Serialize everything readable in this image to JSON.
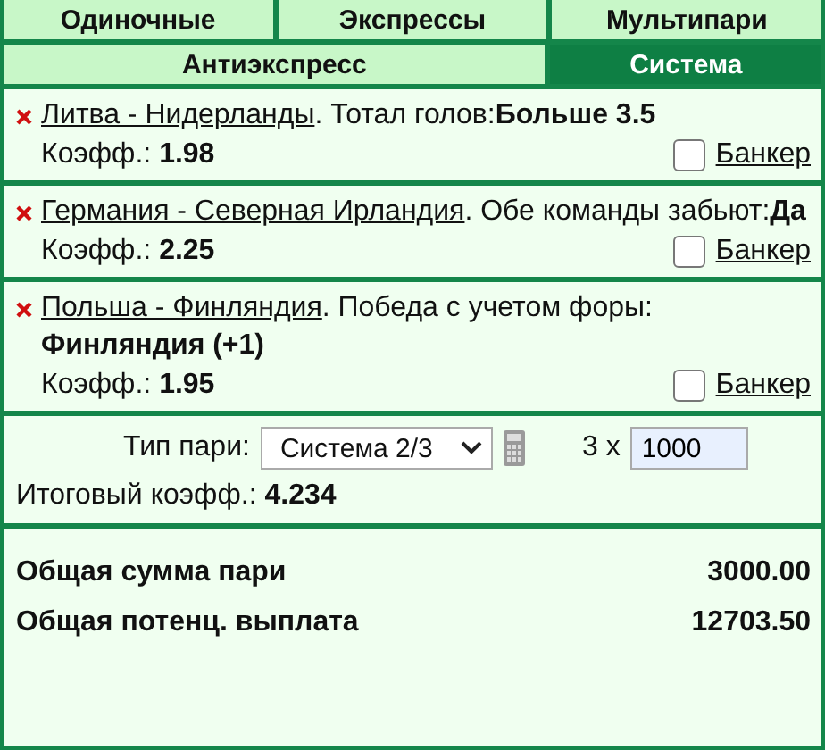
{
  "tab_rows": [
    [
      {
        "label": "Одиночные",
        "selected": false
      },
      {
        "label": "Экспрессы",
        "selected": false
      },
      {
        "label": "Мультипари",
        "selected": false
      }
    ],
    [
      {
        "label": "Антиэкспресс",
        "selected": false
      },
      {
        "label": "Система",
        "selected": true
      }
    ]
  ],
  "bets": [
    {
      "event": "Литва - Нидерланды",
      "market": ". Тотал голов:**Больше 3.5**",
      "odds_label": "Коэфф.:",
      "odds": "1.98",
      "banker_label": "Банкер",
      "banker": false
    },
    {
      "event": "Германия - Северная Ирландия",
      "market": ". Обе команды забьют:**Да**",
      "odds_label": "Коэфф.:",
      "odds": "2.25",
      "banker_label": "Банкер",
      "banker": false
    },
    {
      "event": "Польша - Финляндия",
      "market": ". Победа с учетом форы: **Финляндия (+1)**",
      "odds_label": "Коэфф.:",
      "odds": "1.95",
      "banker_label": "Банкер",
      "banker": false
    }
  ],
  "system": {
    "type_label": "Тип пари:",
    "type_value": "Система 2/3",
    "multiplier": "3 x",
    "stake": "1000",
    "total_odds_label": "Итоговый коэфф.:",
    "total_odds": "4.234"
  },
  "totals": [
    {
      "label": "Общая сумма пари",
      "value": "3000.00"
    },
    {
      "label": "Общая потенц. выплата",
      "value": "12703.50"
    }
  ]
}
